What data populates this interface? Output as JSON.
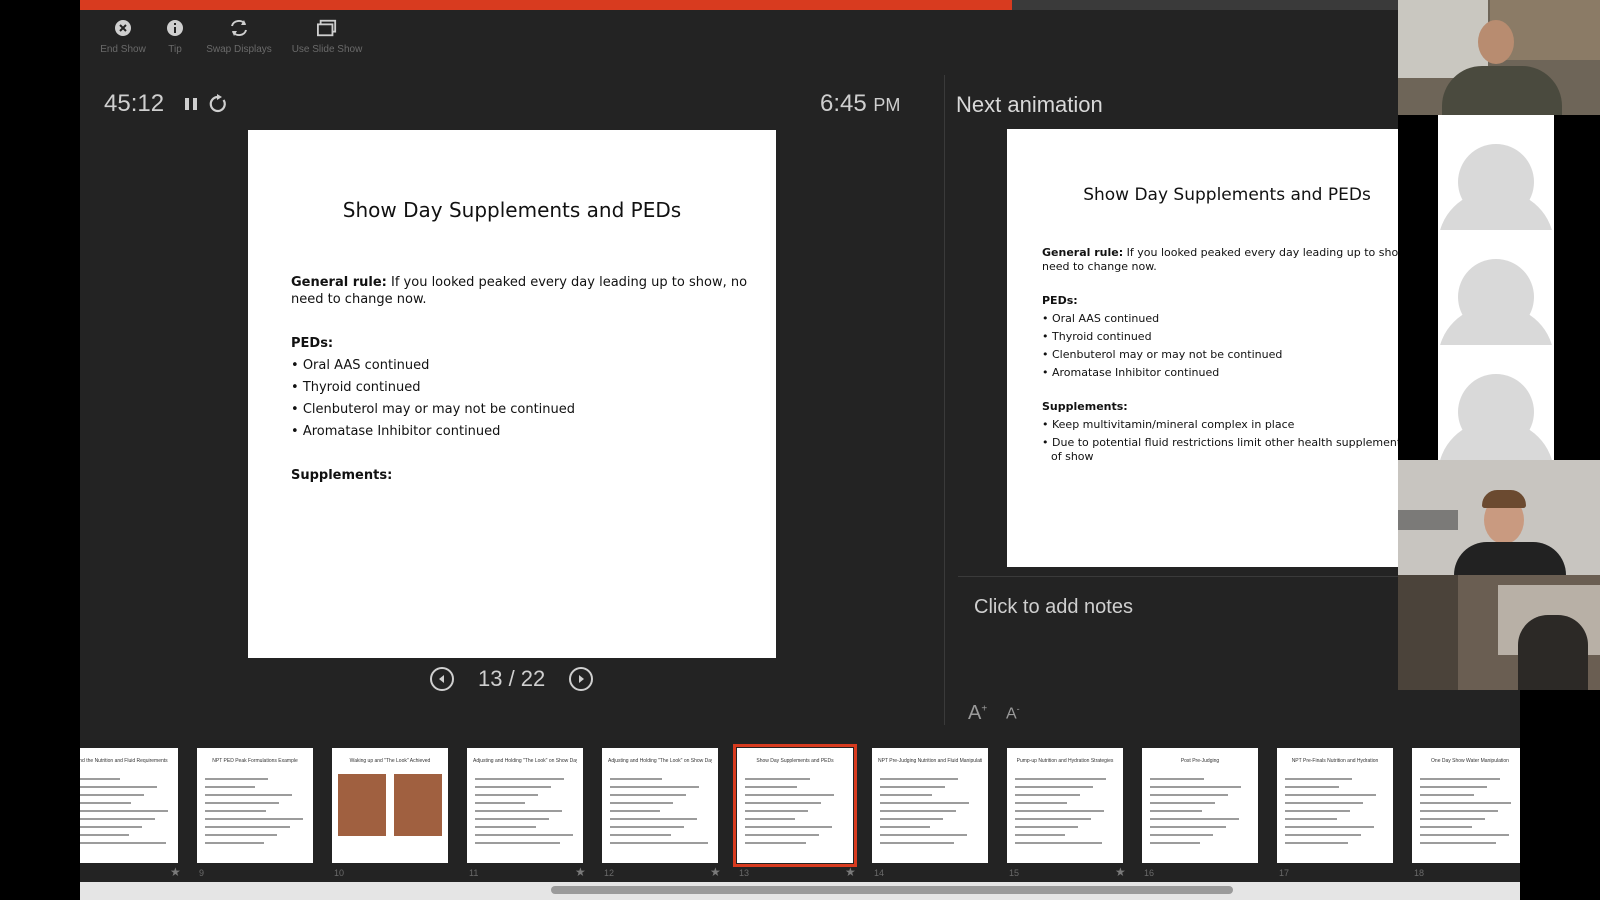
{
  "toolbar": {
    "items": [
      {
        "label": "End Show",
        "icon": "close-circle-icon"
      },
      {
        "label": "Tip",
        "icon": "info-icon"
      },
      {
        "label": "Swap Displays",
        "icon": "swap-icon"
      },
      {
        "label": "Use Slide Show",
        "icon": "window-icon"
      }
    ]
  },
  "progress": {
    "fraction": 0.685
  },
  "timer": "45:12",
  "clock": {
    "time": "6:45",
    "ampm": "PM"
  },
  "current_slide": {
    "title": "Show Day Supplements and PEDs",
    "rule_label": "General rule:",
    "rule_text": " If you looked peaked every day leading up to show, no need to change now.",
    "peds_label": "PEDs:",
    "peds": [
      "Oral AAS continued",
      "Thyroid continued",
      "Clenbuterol may or may not be continued",
      "Aromatase Inhibitor continued"
    ],
    "supplements_label": "Supplements:"
  },
  "next": {
    "label": "Next animation",
    "title": "Show Day Supplements and PEDs",
    "rule_label": "General rule:",
    "rule_text": " If you looked peaked every day leading up to show, no",
    "rule_text_2": "need to change now.",
    "peds_label": "PEDs:",
    "peds": [
      "Oral AAS continued",
      "Thyroid continued",
      "Clenbuterol may or may not be continued",
      "Aromatase Inhibitor continued"
    ],
    "supplements_label": "Supplements:",
    "supplements": [
      "Keep multivitamin/mineral complex in place",
      "Due to potential fluid restrictions limit other health supplements da"
    ],
    "supplement_wrap": "of show"
  },
  "navigation": {
    "counter": "13 / 22"
  },
  "notes": {
    "placeholder": "Click to add notes"
  },
  "font_controls": {
    "increase": "A",
    "decrease": "A"
  },
  "thumbnails": [
    {
      "title": "...and the Nutrition and Fluid Requirements",
      "number": "",
      "star": true
    },
    {
      "title": "NPT PED Peak Formulations Example",
      "number": "9",
      "star": false
    },
    {
      "title": "Waking up and \"The Look\" Achieved",
      "number": "10",
      "star": false
    },
    {
      "title": "Adjusting and Holding \"The Look\" on Show Day",
      "number": "11",
      "star": true
    },
    {
      "title": "Adjusting and Holding \"The Look\" on Show Day",
      "number": "12",
      "star": true
    },
    {
      "title": "Show Day Supplements and PEDs",
      "number": "13",
      "star": true
    },
    {
      "title": "NPT Pre-Judging Nutrition and Fluid Manipulation",
      "number": "14",
      "star": false
    },
    {
      "title": "Pump-up Nutrition and Hydration Strategies",
      "number": "15",
      "star": true
    },
    {
      "title": "Post Pre-Judging",
      "number": "16",
      "star": false
    },
    {
      "title": "NPT Pre-Finals Nutrition and Hydration",
      "number": "17",
      "star": false
    },
    {
      "title": "One Day Show Water Manipulation",
      "number": "18",
      "star": false
    }
  ],
  "colors": {
    "accent": "#d83b1f",
    "panel": "#232323",
    "text": "#cfcfcf"
  }
}
